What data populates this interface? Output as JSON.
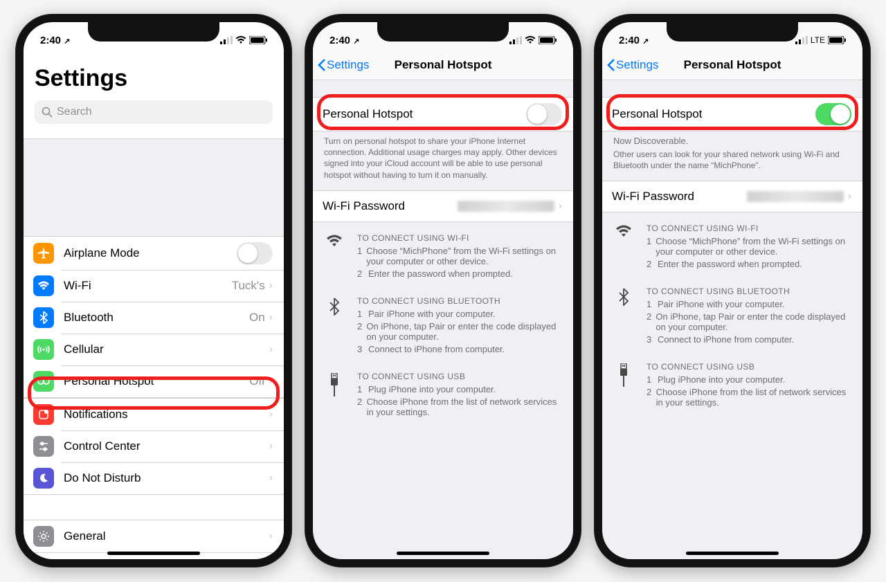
{
  "status": {
    "time": "2:40",
    "signal_text": "LTE"
  },
  "screen1": {
    "title": "Settings",
    "search_placeholder": "Search",
    "rows": {
      "airplane": "Airplane Mode",
      "wifi": "Wi-Fi",
      "wifi_val": "Tuck's",
      "bt": "Bluetooth",
      "bt_val": "On",
      "cellular": "Cellular",
      "hotspot": "Personal Hotspot",
      "hotspot_val": "Off",
      "notifications": "Notifications",
      "control": "Control Center",
      "dnd": "Do Not Disturb",
      "general": "General"
    }
  },
  "screen2": {
    "back": "Settings",
    "title": "Personal Hotspot",
    "toggle_label": "Personal Hotspot",
    "desc": "Turn on personal hotspot to share your iPhone Internet connection. Additional usage charges may apply. Other devices signed into your iCloud account will be able to use personal hotspot without having to turn it on manually.",
    "wifi_pw": "Wi-Fi Password",
    "wifi_hdr": "TO CONNECT USING WI-FI",
    "wifi_1": "Choose “MichPhone” from the Wi-Fi settings on your computer or other device.",
    "wifi_2": "Enter the password when prompted.",
    "bt_hdr": "TO CONNECT USING BLUETOOTH",
    "bt_1": "Pair iPhone with your computer.",
    "bt_2": "On iPhone, tap Pair or enter the code displayed on your computer.",
    "bt_3": "Connect to iPhone from computer.",
    "usb_hdr": "TO CONNECT USING USB",
    "usb_1": "Plug iPhone into your computer.",
    "usb_2": "Choose iPhone from the list of network services in your settings."
  },
  "screen3": {
    "back": "Settings",
    "title": "Personal Hotspot",
    "toggle_label": "Personal Hotspot",
    "now": "Now Discoverable.",
    "desc": "Other users can look for your shared network using Wi-Fi and Bluetooth under the name “MichPhone”.",
    "wifi_pw": "Wi-Fi Password",
    "wifi_hdr": "TO CONNECT USING WI-FI",
    "wifi_1": "Choose “MichPhone” from the Wi-Fi settings on your computer or other device.",
    "wifi_2": "Enter the password when prompted.",
    "bt_hdr": "TO CONNECT USING BLUETOOTH",
    "bt_1": "Pair iPhone with your computer.",
    "bt_2": "On iPhone, tap Pair or enter the code displayed on your computer.",
    "bt_3": "Connect to iPhone from computer.",
    "usb_hdr": "TO CONNECT USING USB",
    "usb_1": "Plug iPhone into your computer.",
    "usb_2": "Choose iPhone from the list of network services in your settings."
  }
}
